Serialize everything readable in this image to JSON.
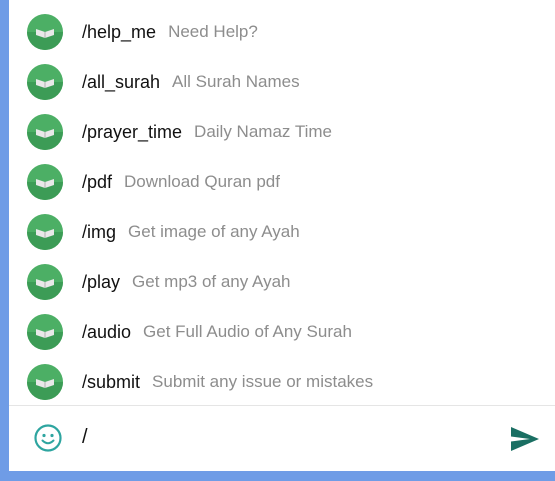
{
  "commands": [
    {
      "command": "/help_me",
      "description": "Need Help?"
    },
    {
      "command": "/all_surah",
      "description": "All Surah Names"
    },
    {
      "command": "/prayer_time",
      "description": "Daily Namaz Time"
    },
    {
      "command": "/pdf",
      "description": "Download Quran pdf"
    },
    {
      "command": "/img",
      "description": "Get image of any Ayah"
    },
    {
      "command": "/play",
      "description": "Get mp3 of any Ayah"
    },
    {
      "command": "/audio",
      "description": "Get Full Audio of Any Surah"
    },
    {
      "command": "/submit",
      "description": "Submit any issue or mistakes"
    }
  ],
  "input": {
    "value": "/"
  },
  "colors": {
    "accent": "#2ea5a0",
    "avatar": "#4caf65",
    "send": "#1a6f63",
    "border": "#6f9ce6"
  },
  "icons": {
    "emoji": "smiley-icon",
    "send": "send-icon",
    "avatar": "quran-book-icon"
  }
}
